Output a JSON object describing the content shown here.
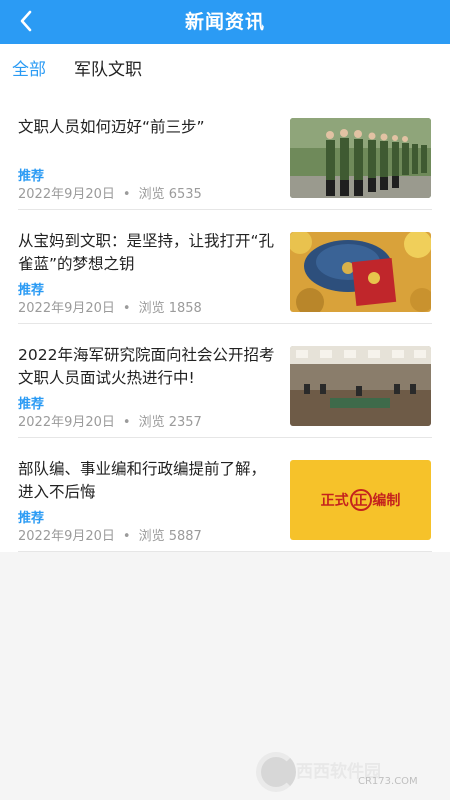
{
  "header": {
    "title": "新闻资讯",
    "back_icon": "chevron-left-icon"
  },
  "tabs": [
    {
      "label": "全部",
      "active": true
    },
    {
      "label": "军队文职",
      "active": false
    }
  ],
  "articles": [
    {
      "title": "文职人员如何迈好“前三步”",
      "tag": "推荐",
      "date": "2022年9月20日",
      "dot": "•",
      "views": "浏览 6535"
    },
    {
      "title": "从宝妈到文职：是坚持，让我打开“孔雀蓝”的梦想之钥",
      "tag": "推荐",
      "date": "2022年9月20日",
      "dot": "•",
      "views": "浏览 1858"
    },
    {
      "title": "2022年海军研究院面向社会公开招考文职人员面试火热进行中!",
      "tag": "推荐",
      "date": "2022年9月20日",
      "dot": "•",
      "views": "浏览 2357"
    },
    {
      "title": "部队编、事业编和行政编提前了解，进入不后悔",
      "tag": "推荐",
      "date": "2022年9月20日",
      "dot": "•",
      "views": "浏览 5887"
    }
  ],
  "thumb4_text": "正式 正 编制",
  "watermark": {
    "brand": "西西软件园",
    "site": "CR173.COM"
  },
  "colors": {
    "accent": "#2b9bf4",
    "background": "#f5f5f5"
  }
}
